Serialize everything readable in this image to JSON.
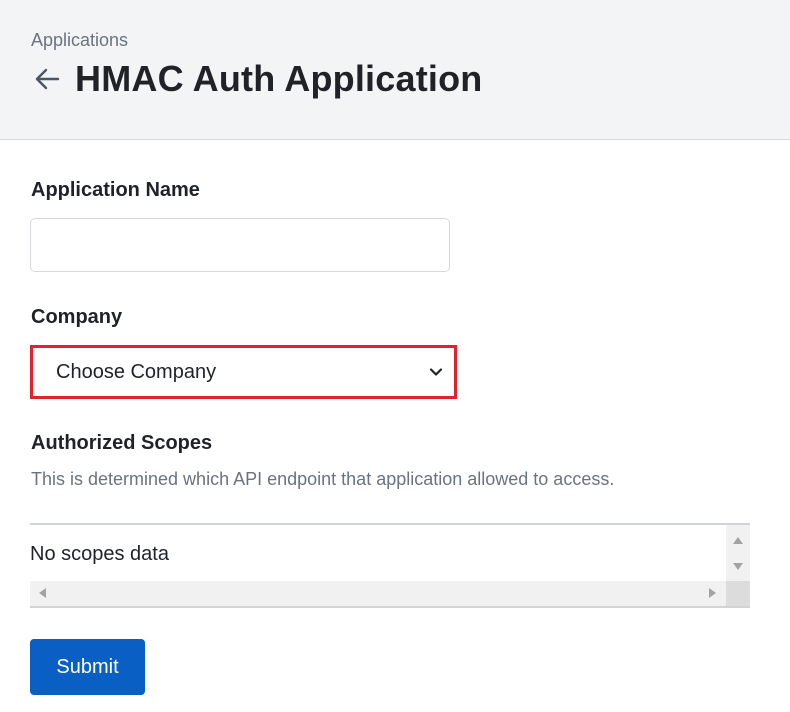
{
  "header": {
    "breadcrumb": "Applications",
    "back_icon": "arrow-left-icon",
    "title": "HMAC Auth Application"
  },
  "form": {
    "name_label": "Application Name",
    "name_value": "",
    "company_label": "Company",
    "company_selected": "Choose Company",
    "company_icon": "chevron-down-icon",
    "scopes_label": "Authorized Scopes",
    "scopes_description": "This is determined which API endpoint that application allowed to access.",
    "scopes_empty": "No scopes data",
    "submit_label": "Submit"
  },
  "colors": {
    "header_bg": "#f3f4f6",
    "highlight_border": "#e0232e",
    "primary_button": "#0a5fc4",
    "muted_text": "#6b7280"
  }
}
